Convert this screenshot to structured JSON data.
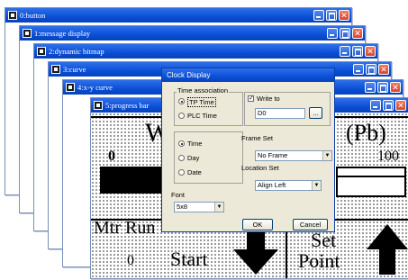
{
  "windows": [
    {
      "title": "0:button"
    },
    {
      "title": "1:message display"
    },
    {
      "title": "2:dynamic bitmap"
    },
    {
      "title": "3:curve"
    },
    {
      "title": "4:x-y curve"
    },
    {
      "title": "5:progress bar"
    }
  ],
  "front_content": {
    "top_left_char": "W",
    "top_right_text": "(Pb)",
    "left_zero": "0",
    "right_value": "100",
    "mtr_label": "Mtr Run",
    "start_value": "0",
    "start_label": "Start",
    "set_label": "Set",
    "point_label": "Point"
  },
  "dialog": {
    "title": "Clock Display",
    "time_association": {
      "label": "Time association",
      "options": [
        "TP Time",
        "PLC Time"
      ],
      "selected": "TP Time"
    },
    "write_to": {
      "label": "Write to",
      "checked": true,
      "value": "D0",
      "browse_label": "..."
    },
    "format": {
      "options": [
        "Time",
        "Day",
        "Date"
      ],
      "selected": "Time"
    },
    "frame_set": {
      "label": "Frame Set",
      "value": "No Frame"
    },
    "location_set": {
      "label": "Location Set",
      "value": "Align Left"
    },
    "font": {
      "label": "Font",
      "value": "5x8"
    },
    "ok_label": "OK",
    "cancel_label": "Cancel"
  },
  "colors": {
    "titlebar": "#0a4fd8",
    "close": "#d8442a",
    "dialog_bg": "#ece9d8"
  },
  "icons": {
    "window": "app-icon",
    "minimize": "minimize-icon",
    "maximize": "maximize-icon",
    "close": "close-icon",
    "dropdown": "chevron-down-icon",
    "arrow_down": "arrow-down-icon",
    "arrow_up": "arrow-up-icon"
  }
}
